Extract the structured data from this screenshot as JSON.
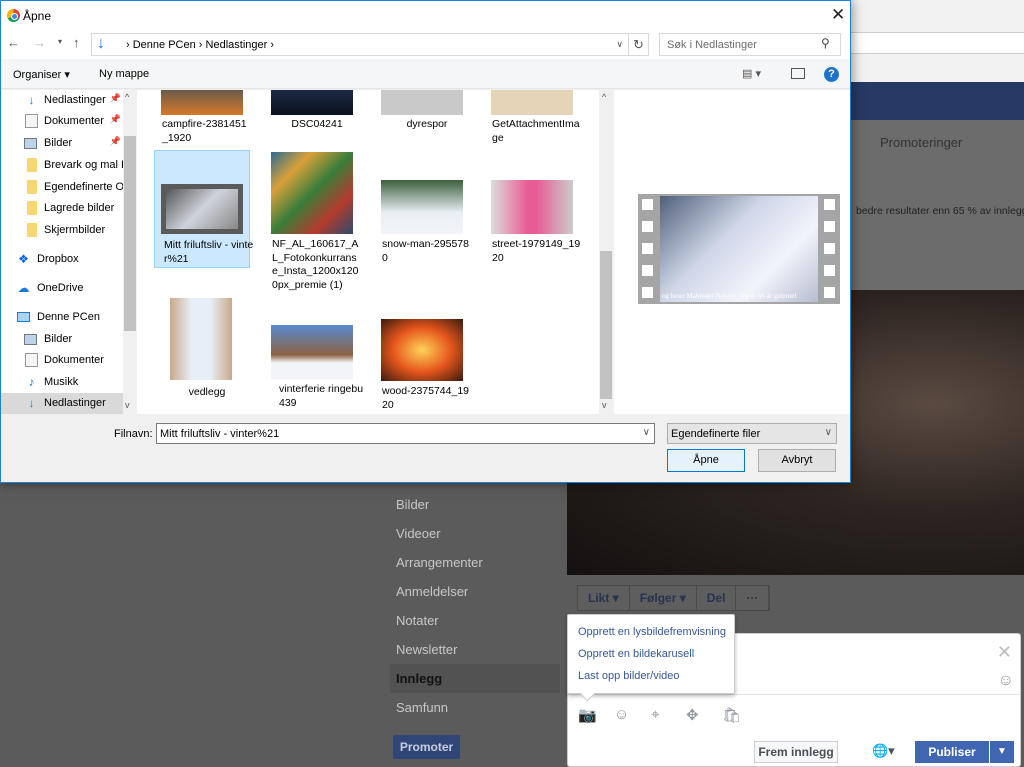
{
  "dialog": {
    "title": "Åpne",
    "breadcrumb": [
      "Denne PCen",
      "Nedlastinger"
    ],
    "search_placeholder": "Søk i Nedlastinger",
    "toolbar": {
      "organise": "Organiser ▾",
      "new_folder": "Ny mappe"
    },
    "nav_items": [
      {
        "label": "Nedlastinger",
        "icon": "download-icon",
        "pinned": true
      },
      {
        "label": "Dokumenter",
        "icon": "document-icon",
        "pinned": true
      },
      {
        "label": "Bilder",
        "icon": "pictures-icon",
        "pinned": true
      },
      {
        "label": "Brevark og mal F",
        "icon": "folder-icon"
      },
      {
        "label": "Egendefinerte O",
        "icon": "folder-icon"
      },
      {
        "label": "Lagrede bilder",
        "icon": "folder-icon"
      },
      {
        "label": "Skjermbilder",
        "icon": "folder-icon"
      },
      {
        "label": "Dropbox",
        "icon": "dropbox-icon"
      },
      {
        "label": "OneDrive",
        "icon": "cloud-icon"
      },
      {
        "label": "Denne PCen",
        "icon": "computer-icon"
      },
      {
        "label": "Bilder",
        "icon": "pictures-icon"
      },
      {
        "label": "Dokumenter",
        "icon": "document-icon"
      },
      {
        "label": "Musikk",
        "icon": "music-icon"
      },
      {
        "label": "Nedlastinger",
        "icon": "download-icon",
        "selected": true
      }
    ],
    "files": [
      {
        "name": "campfire-2381451_1920"
      },
      {
        "name": "DSC04241"
      },
      {
        "name": "dyrespor"
      },
      {
        "name": "GetAttachmentImage"
      },
      {
        "name": "Mitt friluftsliv - vinter%21",
        "selected": true
      },
      {
        "name": "NF_AL_160617_AL_Fotokonkurranse_Insta_1200x1200px_premie (1)"
      },
      {
        "name": "snow-man-2955780"
      },
      {
        "name": "street-1979149_1920"
      },
      {
        "name": "vedlegg"
      },
      {
        "name": "vinterferie ringebu 439"
      },
      {
        "name": "wood-2375744_1920"
      }
    ],
    "preview_caption": "og heter Mahinder Navarn. Jeg er 66 år gammel",
    "filename_label": "Filnavn:",
    "filename_value": "Mitt friluftsliv - vinter%21",
    "filetype": "Egendefinerte filer",
    "open_label": "Åpne",
    "cancel_label": "Avbryt"
  },
  "page": {
    "promo_tab": "Promoteringer",
    "promo_text": "bedre resultater enn 65 % av innlegg",
    "left_menu": [
      "Bilder",
      "Videoer",
      "Arrangementer",
      "Anmeldelser",
      "Notater",
      "Newsletter",
      "Innlegg",
      "Samfunn"
    ],
    "active_menu": "Innlegg",
    "promote_button": "Promoter",
    "actions": [
      "Likt ▾",
      "Følger ▾",
      "Del",
      "···"
    ],
    "photo_menu": [
      "Opprett en lysbildefremvisning",
      "Opprett en bildekarusell",
      "Last opp bilder/video"
    ],
    "boost_label": "Frem innlegg",
    "publish_label": "Publiser"
  },
  "colors": {
    "accent": "#0078d7",
    "fb_blue": "#4267b2",
    "selection": "#cce8ff"
  }
}
